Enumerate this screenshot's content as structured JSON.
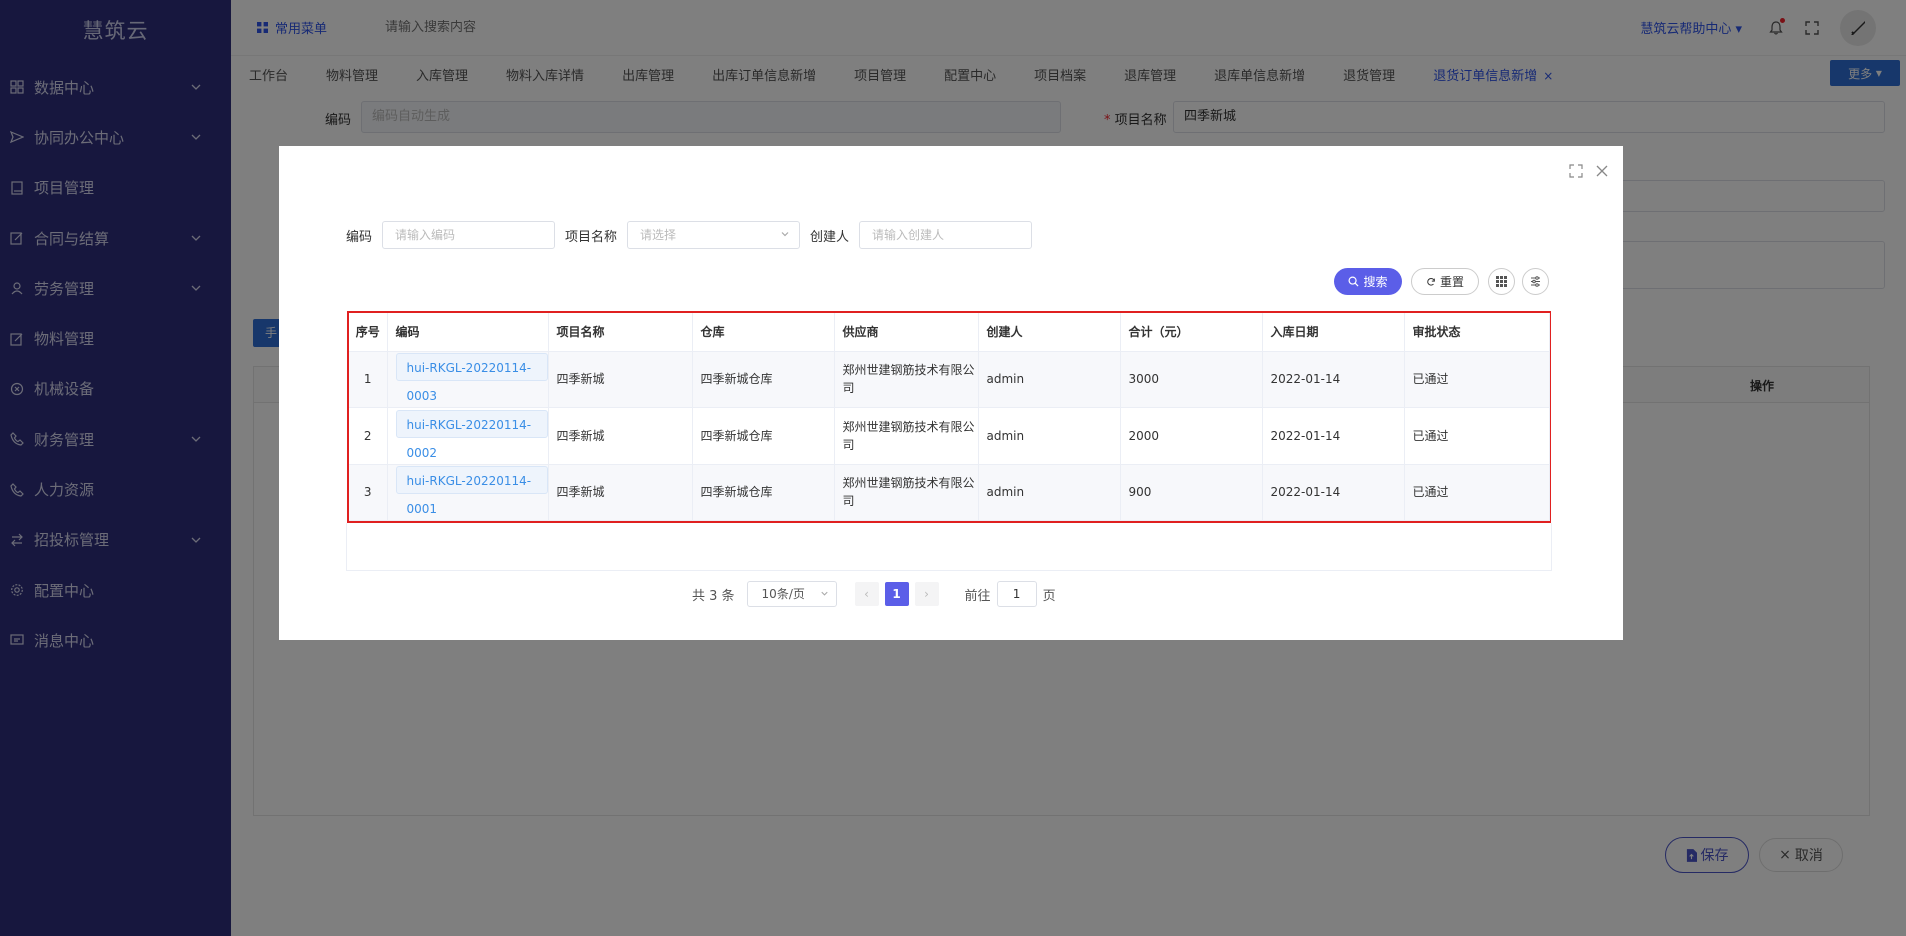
{
  "app": {
    "title": "慧筑云"
  },
  "sidebar": {
    "items": [
      {
        "label": "数据中心",
        "icon": "grid-icon",
        "expandable": true
      },
      {
        "label": "协同办公中心",
        "icon": "send-icon",
        "expandable": true
      },
      {
        "label": "项目管理",
        "icon": "book-icon",
        "expandable": false
      },
      {
        "label": "合同与结算",
        "icon": "edit-icon",
        "expandable": true
      },
      {
        "label": "劳务管理",
        "icon": "user-icon",
        "expandable": true
      },
      {
        "label": "物料管理",
        "icon": "edit-icon",
        "expandable": false
      },
      {
        "label": "机械设备",
        "icon": "circle-x-icon",
        "expandable": false
      },
      {
        "label": "财务管理",
        "icon": "phone-icon",
        "expandable": true
      },
      {
        "label": "人力资源",
        "icon": "phone-icon",
        "expandable": false
      },
      {
        "label": "招投标管理",
        "icon": "swap-icon",
        "expandable": true
      },
      {
        "label": "配置中心",
        "icon": "gear-icon",
        "expandable": false
      },
      {
        "label": "消息中心",
        "icon": "message-icon",
        "expandable": false
      }
    ]
  },
  "header": {
    "menu_label": "常用菜单",
    "search_placeholder": "请输入搜索内容",
    "help_label": "慧筑云帮助中心"
  },
  "tabs": {
    "items": [
      "工作台",
      "物料管理",
      "入库管理",
      "物料入库详情",
      "出库管理",
      "出库订单信息新增",
      "项目管理",
      "配置中心",
      "项目档案",
      "退库管理",
      "退库单信息新增",
      "退货管理"
    ],
    "active": "退货订单信息新增",
    "more_label": "更多"
  },
  "bg_form": {
    "code_label": "编码",
    "code_placeholder": "编码自动生成",
    "project_label": "项目名称",
    "project_value": "四季新城",
    "ops_header": "操作",
    "add_button_label": "手",
    "save_label": "保存",
    "cancel_label": "取消"
  },
  "modal": {
    "filters": {
      "code_label": "编码",
      "code_placeholder": "请输入编码",
      "project_label": "项目名称",
      "project_placeholder": "请选择",
      "creator_label": "创建人",
      "creator_placeholder": "请输入创建人"
    },
    "search_label": "搜索",
    "reset_label": "重置",
    "columns": [
      "序号",
      "编码",
      "项目名称",
      "仓库",
      "供应商",
      "创建人",
      "合计（元）",
      "入库日期",
      "审批状态"
    ],
    "rows": [
      {
        "idx": "1",
        "code": "hui-RKGL-20220114-0003",
        "project": "四季新城",
        "warehouse": "四季新城仓库",
        "supplier": "郑州世建钢筋技术有限公司",
        "creator": "admin",
        "total": "3000",
        "date": "2022-01-14",
        "status": "已通过"
      },
      {
        "idx": "2",
        "code": "hui-RKGL-20220114-0002",
        "project": "四季新城",
        "warehouse": "四季新城仓库",
        "supplier": "郑州世建钢筋技术有限公司",
        "creator": "admin",
        "total": "2000",
        "date": "2022-01-14",
        "status": "已通过"
      },
      {
        "idx": "3",
        "code": "hui-RKGL-20220114-0001",
        "project": "四季新城",
        "warehouse": "四季新城仓库",
        "supplier": "郑州世建钢筋技术有限公司",
        "creator": "admin",
        "total": "900",
        "date": "2022-01-14",
        "status": "已通过"
      }
    ],
    "pager": {
      "total_text": "共 3 条",
      "page_size": "10条/页",
      "current_page": "1",
      "goto_prefix": "前往",
      "goto_value": "1",
      "goto_suffix": "页"
    }
  },
  "colors": {
    "sidebar_bg": "#2e2f7c",
    "accent": "#5b5ee8",
    "highlight_border": "#e02020",
    "link": "#3a8ee6"
  }
}
